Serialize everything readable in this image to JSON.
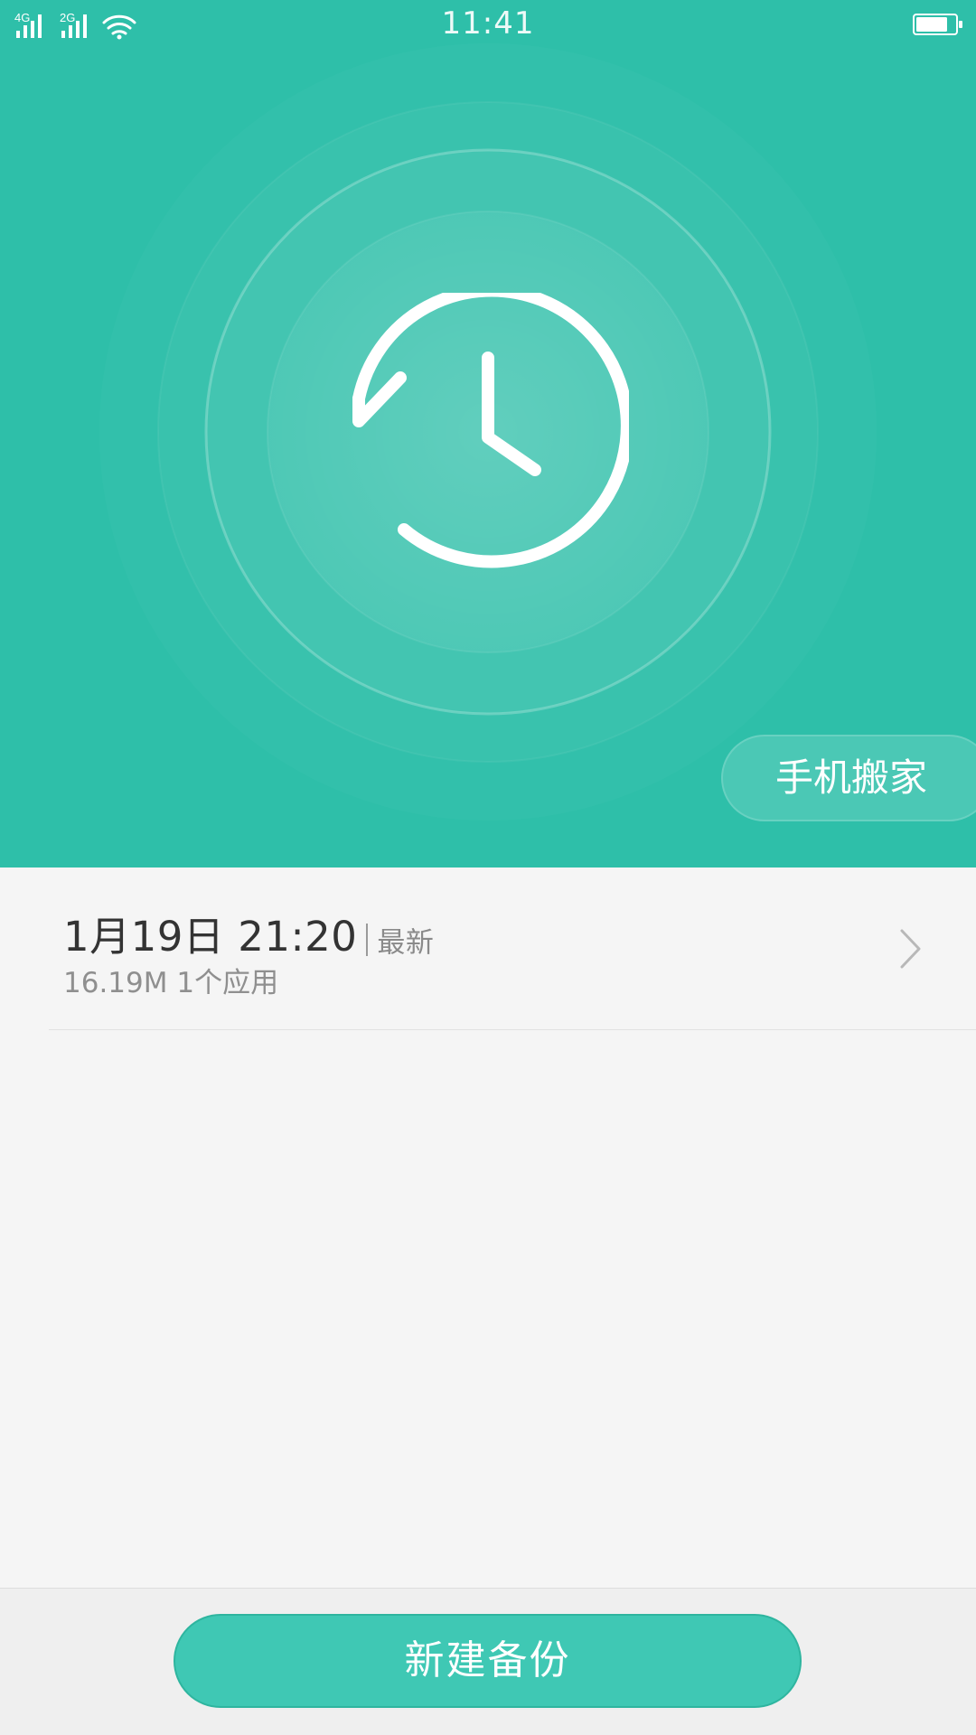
{
  "status_bar": {
    "time": "11:41",
    "network_1": "4G",
    "network_2": "2G",
    "icons": [
      "signal-icon",
      "signal-icon",
      "wifi-icon",
      "battery-icon"
    ]
  },
  "hero": {
    "icon": "clock-history-icon",
    "action_button_label": "手机搬家"
  },
  "backups": [
    {
      "date": "1月19日 21:20",
      "tag": "最新",
      "size": "16.19M",
      "apps": "1个应用"
    }
  ],
  "bottom_bar": {
    "primary_button_label": "新建备份"
  },
  "colors": {
    "brand": "#2ebfa9",
    "button": "#3fc8b4",
    "text_primary": "#333333",
    "text_secondary": "#8f8f8f"
  }
}
